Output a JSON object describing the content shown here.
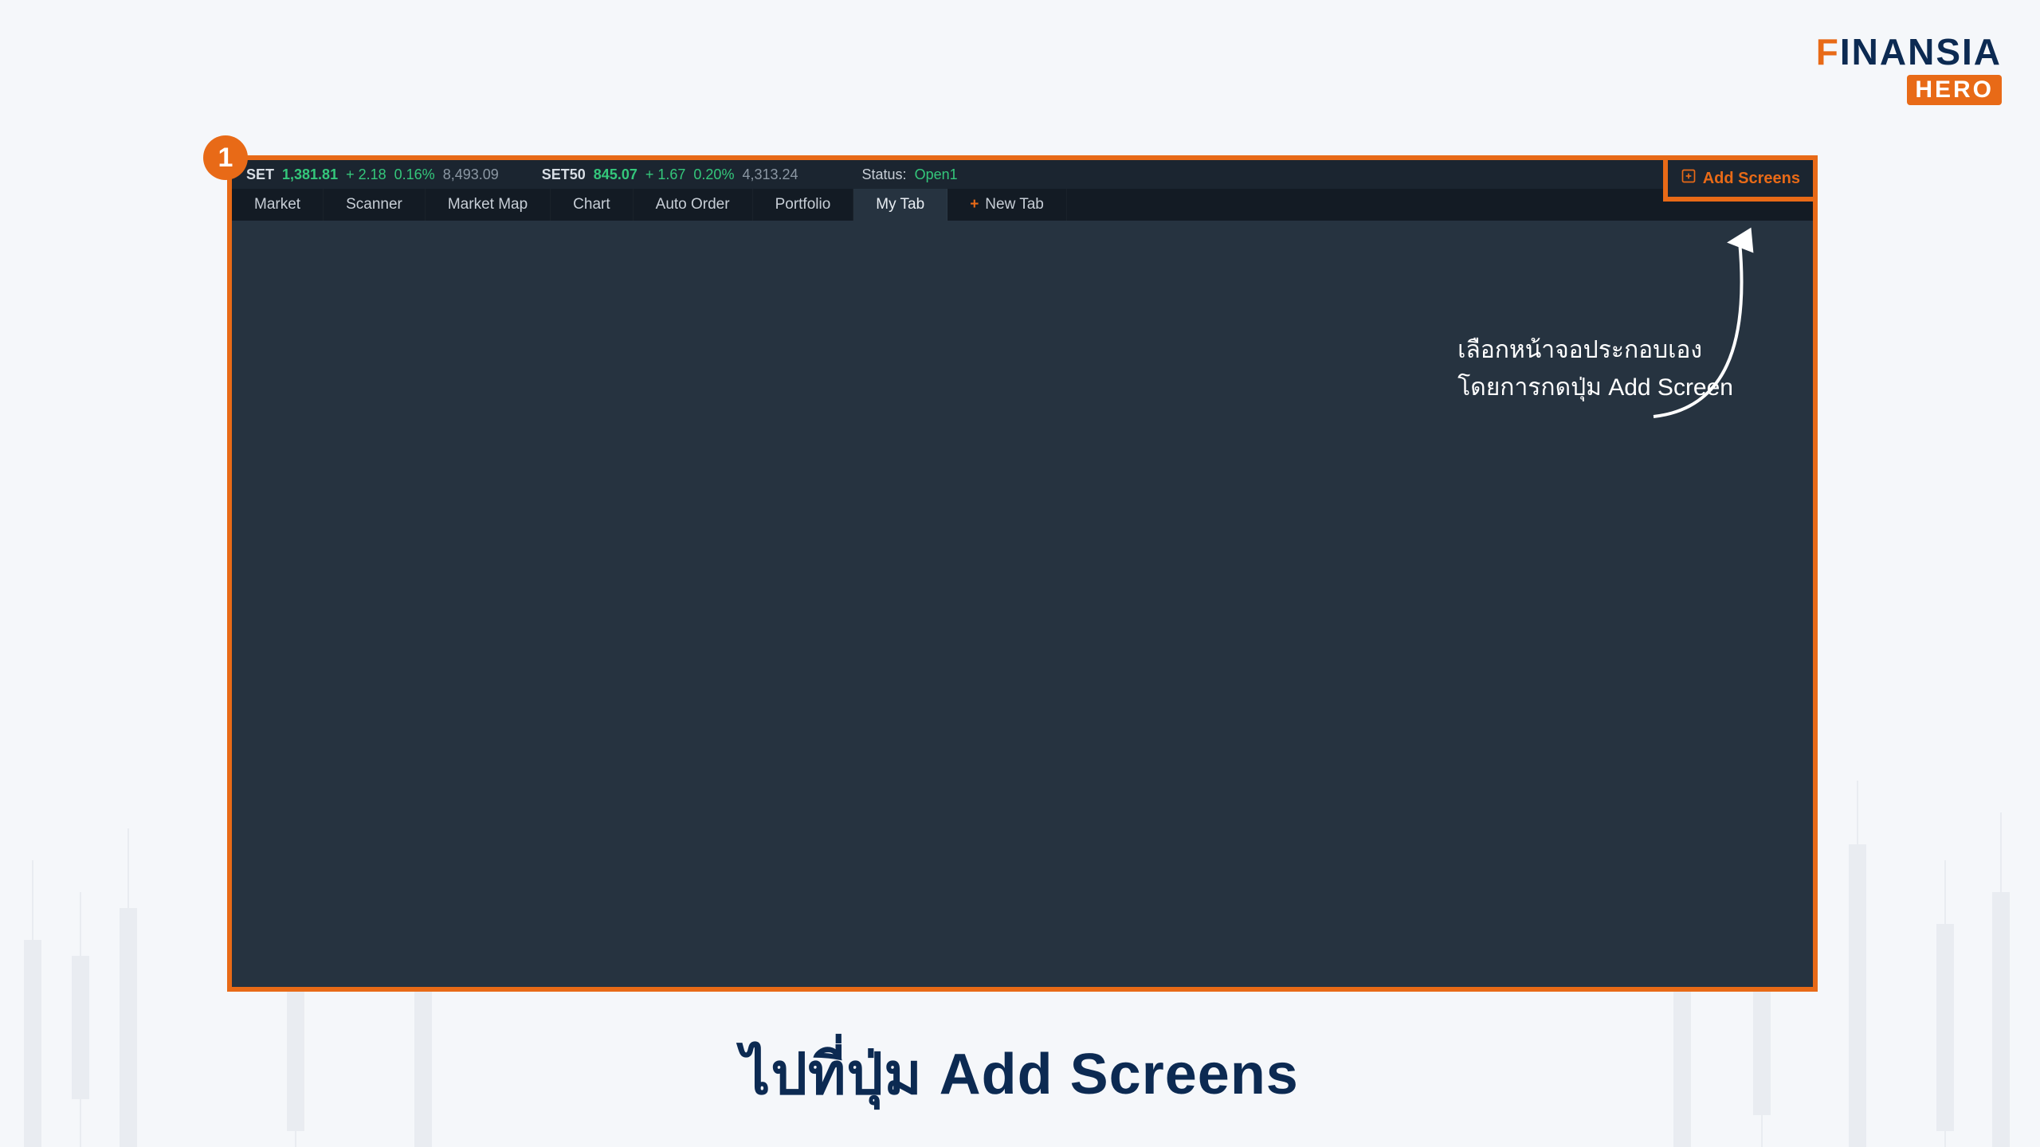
{
  "brand": {
    "name_prefix": "F",
    "name_rest": "INANSIA",
    "sub": "HERO"
  },
  "step": {
    "number": "1"
  },
  "ticker": {
    "set": {
      "sym": "SET",
      "val": "1,381.81",
      "chg": "+ 2.18",
      "pct": "0.16%",
      "vol": "8,493.09"
    },
    "set50": {
      "sym": "SET50",
      "val": "845.07",
      "chg": "+ 1.67",
      "pct": "0.20%",
      "vol": "4,313.24"
    },
    "status_label": "Status:",
    "status_value": "Open1"
  },
  "add_screens": {
    "label": "Add Screens"
  },
  "tabs": {
    "items": [
      {
        "label": "Market"
      },
      {
        "label": "Scanner"
      },
      {
        "label": "Market Map"
      },
      {
        "label": "Chart"
      },
      {
        "label": "Auto Order"
      },
      {
        "label": "Portfolio"
      },
      {
        "label": "My Tab"
      }
    ],
    "new_tab_label": "New Tab"
  },
  "annotation": {
    "line1": "เลือกหน้าจอประกอบเอง",
    "line2": "โดยการกดปุ่ม Add Screen"
  },
  "caption": "ไปที่ปุ่ม Add Screens"
}
